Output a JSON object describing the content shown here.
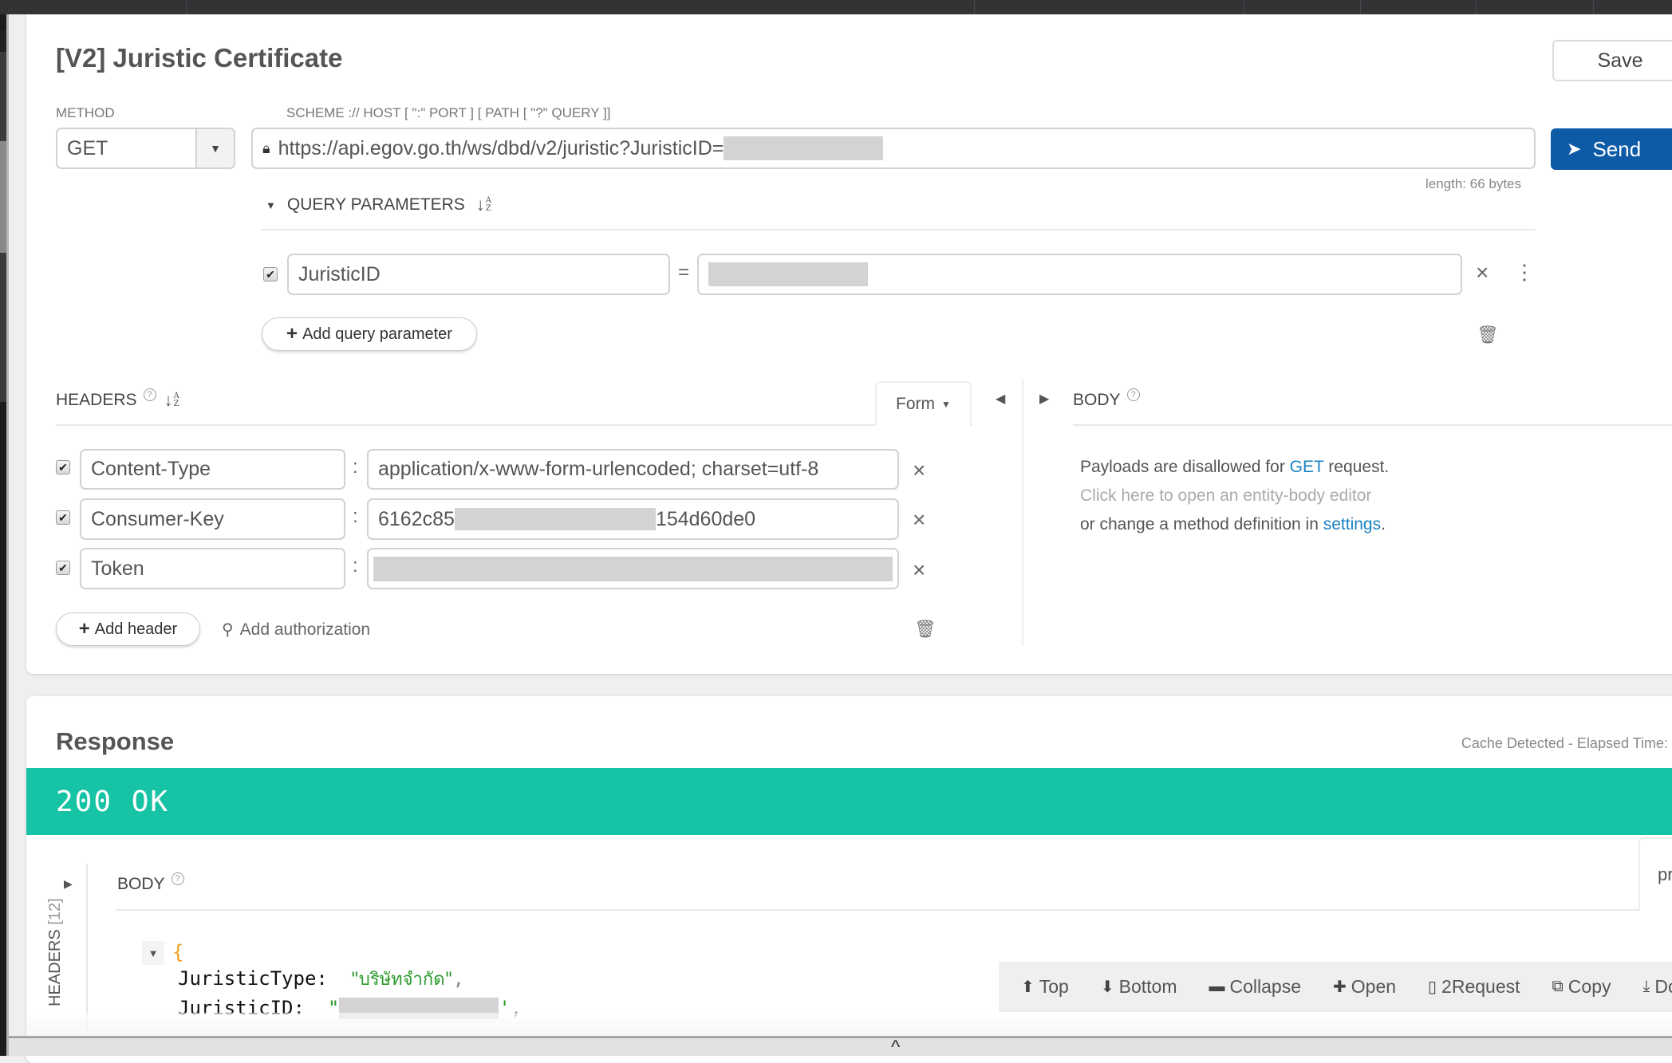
{
  "window": {
    "top_bar_color": "#323335"
  },
  "request": {
    "title": "[V2] Juristic Certificate",
    "save_label": "Save",
    "method_label": "METHOD",
    "method_value": "GET",
    "url_label": "SCHEME :// HOST [ \":\" PORT ] [ PATH [ \"?\" QUERY ]]",
    "url_value": "https://api.egov.go.th/ws/dbd/v2/juristic?JuristicID=",
    "url_redacted": true,
    "send_label": "Send",
    "send_color": "#0d5aa7",
    "length_text": "length: 66 bytes",
    "query": {
      "section_label": "QUERY PARAMETERS",
      "params": [
        {
          "enabled": true,
          "key": "JuristicID",
          "value": "",
          "value_redacted": true
        }
      ],
      "equals": "=",
      "add_label": "Add query parameter"
    },
    "headers": {
      "section_label": "HEADERS",
      "form_tab_label": "Form",
      "separator": ":",
      "rows": [
        {
          "enabled": true,
          "key": "Content-Type",
          "value": "application/x-www-form-urlencoded; charset=utf-8"
        },
        {
          "enabled": true,
          "key": "Consumer-Key",
          "value_prefix": "6162c85",
          "value_suffix": "154d60de0",
          "value_redacted": true
        },
        {
          "enabled": true,
          "key": "Token",
          "value": "",
          "value_redacted": true
        }
      ],
      "add_header_label": "Add header",
      "add_auth_label": "Add authorization"
    },
    "body": {
      "section_label": "BODY",
      "msg_line1_pre": "Payloads are disallowed for ",
      "msg_line1_method": "GET",
      "msg_line1_post": " request.",
      "msg_line2": "Click here to open an entity-body editor",
      "msg_line3_pre": "or change a method definition in ",
      "msg_line3_link": "settings",
      "msg_line3_post": "."
    }
  },
  "response": {
    "title": "Response",
    "cache_text": "Cache Detected - Elapsed Time:",
    "status_text": "200 OK",
    "status_color": "#17c3a5",
    "headers_tab_label": "HEADERS",
    "headers_count": "[12]",
    "body_label": "BODY",
    "format_tab_label": "pr",
    "json": {
      "open_brace": "{",
      "lines": [
        {
          "key": "JuristicType:",
          "value": "\"บริษัทจำกัด\"",
          "trail": ","
        },
        {
          "key": "JuristicID:",
          "value_open": "\"",
          "value_close": "'",
          "value_redacted": true,
          "trail": ","
        }
      ]
    },
    "toolbar": [
      {
        "icon": "arrow-up-circle-icon",
        "glyph": "⬆",
        "label": "Top"
      },
      {
        "icon": "arrow-down-circle-icon",
        "glyph": "⬇",
        "label": "Bottom"
      },
      {
        "icon": "minus-square-icon",
        "glyph": "▬",
        "label": "Collapse"
      },
      {
        "icon": "plus-square-icon",
        "glyph": "✚",
        "label": "Open"
      },
      {
        "icon": "file-request-icon",
        "glyph": "▯",
        "label": "2Request"
      },
      {
        "icon": "copy-icon",
        "glyph": "⧉",
        "label": "Copy"
      },
      {
        "icon": "download-icon",
        "glyph": "⤓",
        "label": "Do"
      }
    ]
  },
  "bottom_bar": {
    "toggle_glyph": "^"
  }
}
